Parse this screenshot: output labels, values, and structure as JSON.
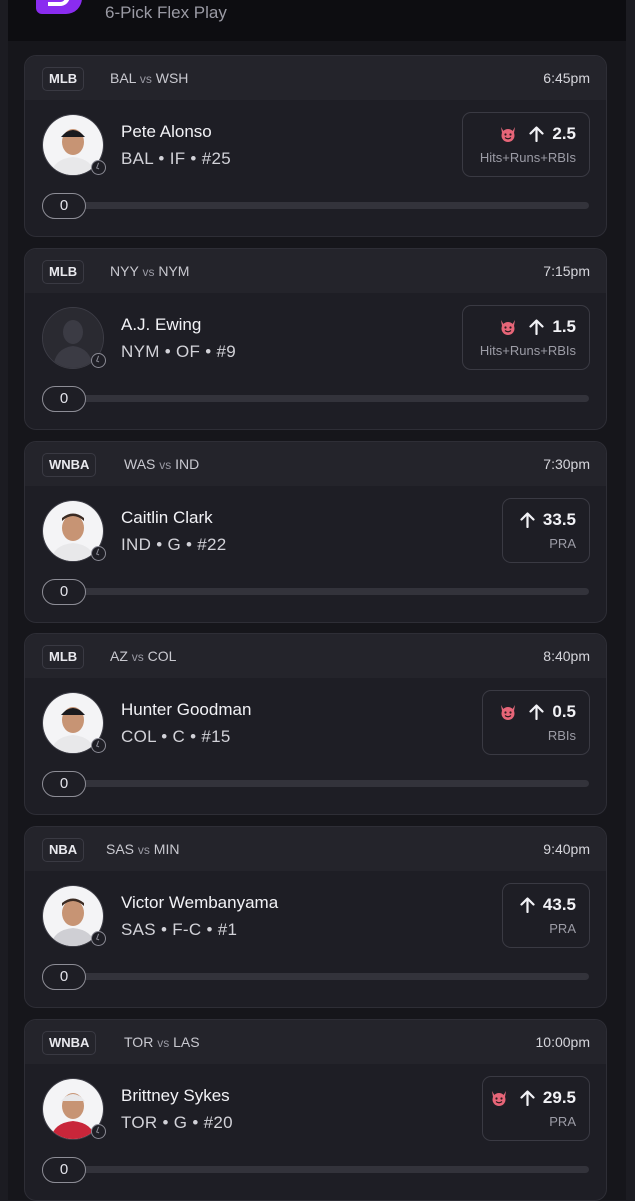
{
  "header": {
    "subtitle": "6-Pick Flex Play"
  },
  "colors": {
    "accent": "#8a2cf0",
    "card": "#1e1e25",
    "card_header": "#24242b"
  },
  "picks": [
    {
      "league": "MLB",
      "home": "BAL",
      "vs": "vs",
      "away": "WSH",
      "time": "6:45pm",
      "name": "Pete Alonso",
      "meta": "BAL • IF • #25",
      "line": "2.5",
      "stat": "Hits+Runs+RBIs",
      "demon": true,
      "direction": "up",
      "progress": "0",
      "avatar": "player-photo"
    },
    {
      "league": "MLB",
      "home": "NYY",
      "vs": "vs",
      "away": "NYM",
      "time": "7:15pm",
      "name": "A.J. Ewing",
      "meta": "NYM • OF • #9",
      "line": "1.5",
      "stat": "Hits+Runs+RBIs",
      "demon": true,
      "direction": "up",
      "progress": "0",
      "avatar": "silhouette"
    },
    {
      "league": "WNBA",
      "home": "WAS",
      "vs": "vs",
      "away": "IND",
      "time": "7:30pm",
      "name": "Caitlin Clark",
      "meta": "IND • G • #22",
      "line": "33.5",
      "stat": "PRA",
      "demon": false,
      "direction": "up",
      "progress": "0",
      "avatar": "player-photo"
    },
    {
      "league": "MLB",
      "home": "AZ",
      "vs": "vs",
      "away": "COL",
      "time": "8:40pm",
      "name": "Hunter Goodman",
      "meta": "COL • C • #15",
      "line": "0.5",
      "stat": "RBIs",
      "demon": true,
      "direction": "up",
      "progress": "0",
      "avatar": "player-photo"
    },
    {
      "league": "NBA",
      "home": "SAS",
      "vs": "vs",
      "away": "MIN",
      "time": "9:40pm",
      "name": "Victor Wembanyama",
      "meta": "SAS • F-C • #1",
      "line": "43.5",
      "stat": "PRA",
      "demon": false,
      "direction": "up",
      "progress": "0",
      "avatar": "player-photo"
    },
    {
      "league": "WNBA",
      "home": "TOR",
      "vs": "vs",
      "away": "LAS",
      "time": "10:00pm",
      "name": "Brittney Sykes",
      "meta": "TOR • G • #20",
      "line": "29.5",
      "stat": "PRA",
      "demon": true,
      "direction": "up",
      "progress": "0",
      "avatar": "player-photo"
    }
  ]
}
